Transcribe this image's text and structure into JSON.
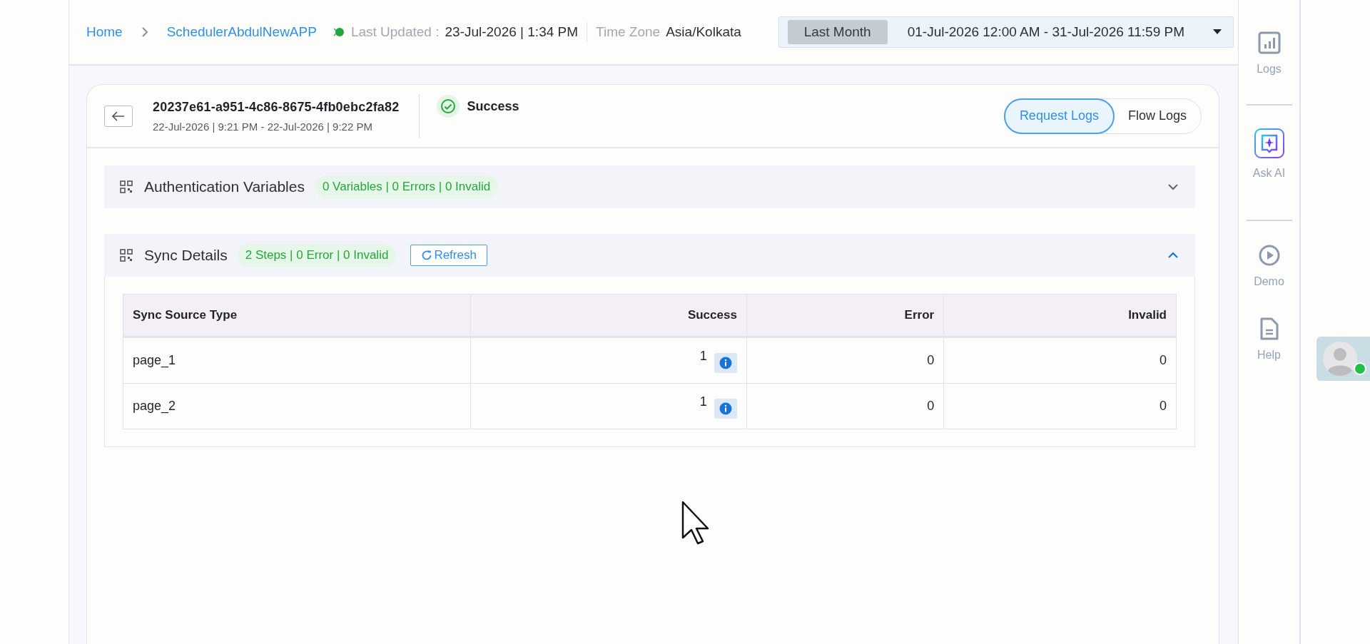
{
  "breadcrumb": [
    {
      "label": "Home"
    },
    {
      "label": "SchedulerAbdulNewAPP"
    }
  ],
  "status_indicator": {
    "color": "#22a83a"
  },
  "last_updated": {
    "label": "Last Updated :",
    "value": "23-Jul-2026 | 1:34 PM"
  },
  "time_zone": {
    "label": "Time Zone",
    "value": "Asia/Kolkata"
  },
  "date_range": {
    "preset": "Last Month",
    "range": "01-Jul-2026 12:00 AM - 31-Jul-2026 11:59 PM"
  },
  "run": {
    "id": "20237e61-a951-4c86-8675-4fb0ebc2fa82",
    "time_range": "22-Jul-2026 | 9:21 PM - 22-Jul-2026 | 9:22 PM",
    "status": "Success"
  },
  "log_tabs": [
    {
      "label": "Request Logs",
      "selected": true
    },
    {
      "label": "Flow Logs",
      "selected": false
    }
  ],
  "sections": [
    {
      "title": "Authentication Variables",
      "summary": "0 Variables | 0 Errors | 0 Invalid",
      "expanded": false
    },
    {
      "title": "Sync Details",
      "summary": "2 Steps | 0 Error | 0 Invalid",
      "expanded": true,
      "refresh_label": "Refresh",
      "table": {
        "columns": [
          "Sync Source Type",
          "Success",
          "Error",
          "Invalid"
        ],
        "rows": [
          {
            "cells": [
              "page_1",
              "1",
              "0",
              "0"
            ]
          },
          {
            "cells": [
              "page_2",
              "1",
              "0",
              "0"
            ]
          }
        ]
      }
    }
  ],
  "sidebar": {
    "items": [
      {
        "kind": "logs",
        "label": "Logs",
        "divider_after": true
      },
      {
        "kind": "ai",
        "label": "Ask AI",
        "divider_after": true
      },
      {
        "kind": "demo",
        "label": "Demo",
        "divider_after": false
      },
      {
        "kind": "help",
        "label": "Help",
        "divider_after": false
      }
    ]
  },
  "avatar": {
    "online": true
  }
}
